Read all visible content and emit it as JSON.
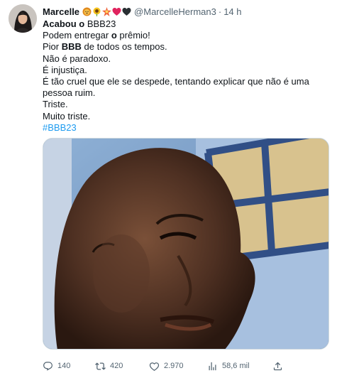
{
  "author": {
    "name": "Marcelle",
    "handle": "@MarcelleHerman3",
    "separator": "·",
    "time": "14 h",
    "emojis": [
      "lion-emoji",
      "sunflower-emoji",
      "sparkle-burst-emoji",
      "red-heart-emoji",
      "black-heart-emoji"
    ]
  },
  "tweet": {
    "line1_a": "Acabou o ",
    "line1_b": "BBB23",
    "line2_a": "Podem entregar ",
    "line2_b": "o",
    "line2_c": " prêmio!",
    "line3_a": "Pior ",
    "line3_b": "BBB",
    "line3_c": " de todos os tempos.",
    "line4": "Não é paradoxo.",
    "line5": "É injustiça.",
    "line6": "É tão cruel que ele se despede, tentando explicar que não é uma pessoa ruim.",
    "line7": "Triste.",
    "line8": "Muito triste.",
    "hashtag": "#BBB23"
  },
  "metrics": {
    "replies": "140",
    "retweets": "420",
    "likes": "2.970",
    "views": "58,6 mil"
  },
  "colors": {
    "text": "#0f1419",
    "secondary": "#536471",
    "link": "#1d9bf0",
    "border": "#cfd9de"
  }
}
